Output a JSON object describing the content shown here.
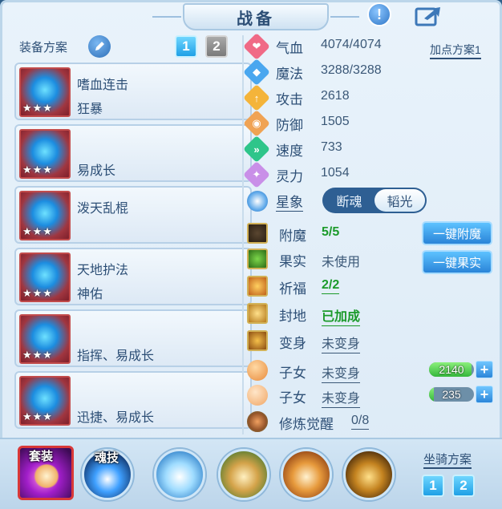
{
  "title": "战备",
  "header": {
    "help_icon": "exclamation-icon",
    "share_icon": "share-icon"
  },
  "equip": {
    "label": "装备方案",
    "tabs": [
      "1",
      "2"
    ],
    "items": [
      {
        "name": "嗜血连击",
        "effect": "狂暴",
        "stars": "★★★"
      },
      {
        "name": "",
        "effect": "易成长",
        "stars": "★★★"
      },
      {
        "name": "泼天乱棍",
        "effect": "",
        "stars": "★★★"
      },
      {
        "name": "天地护法",
        "effect": "神佑",
        "stars": "★★★"
      },
      {
        "name": "",
        "effect": "指挥、易成长",
        "stars": "★★★"
      },
      {
        "name": "",
        "effect": "迅捷、易成长",
        "stars": "★★★"
      }
    ]
  },
  "stats": {
    "plan_link": "加点方案1",
    "items": [
      {
        "name": "气血",
        "value": "4074/4074",
        "color": "#f06a86",
        "glyph": "❤"
      },
      {
        "name": "魔法",
        "value": "3288/3288",
        "color": "#4aa7ef",
        "glyph": "◆"
      },
      {
        "name": "攻击",
        "value": "2618",
        "color": "#f4b43a",
        "glyph": "↑"
      },
      {
        "name": "防御",
        "value": "1505",
        "color": "#f0a354",
        "glyph": "◉"
      },
      {
        "name": "速度",
        "value": "733",
        "color": "#2ec58a",
        "glyph": "»"
      },
      {
        "name": "灵力",
        "value": "1054",
        "color": "#c98fe8",
        "glyph": "✦"
      }
    ]
  },
  "star": {
    "label": "星象",
    "options": [
      "断魂",
      "韬光"
    ],
    "selected": "韬光"
  },
  "extras": {
    "fumo": {
      "label": "附魔",
      "value": "5/5"
    },
    "guoshi": {
      "label": "果实",
      "value": "未使用"
    },
    "qifu": {
      "label": "祈福",
      "value": "2/2"
    },
    "fengdi": {
      "label": "封地",
      "value": "已加成"
    },
    "bianshen": {
      "label": "变身",
      "value": "未变身"
    },
    "child1": {
      "label": "子女",
      "value": "未变身",
      "bar": "2140",
      "fill": 0.95
    },
    "child2": {
      "label": "子女",
      "value": "未变身",
      "bar": "235",
      "fill": 0.1
    },
    "xiulian": {
      "label": "修炼觉醒",
      "value": "0/8"
    },
    "btn_fumo": "一键附魔",
    "btn_guoshi": "一键果实"
  },
  "bottom": {
    "suit_label": "套装",
    "soul_label": "魂技",
    "mount_label": "坐骑方案",
    "mount_tabs": [
      "1",
      "2"
    ]
  }
}
